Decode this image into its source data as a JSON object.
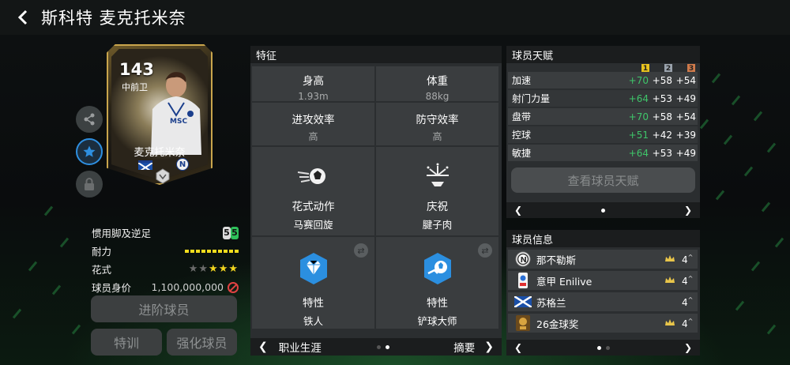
{
  "header": {
    "title": "斯科特 麦克托米奈"
  },
  "card": {
    "rating": "143",
    "position": "中前卫",
    "name": "麦克托米奈"
  },
  "left_stats": {
    "foot_label": "惯用脚及逆足",
    "foot_values": [
      "5",
      "5"
    ],
    "stamina_label": "耐力",
    "stamina_segments": 10,
    "skill_label": "花式",
    "skill_stars": {
      "total": 5,
      "filled": 3
    },
    "value_label": "球员身价",
    "value": "1,100,000,000"
  },
  "buttons": {
    "upgrade": "进阶球员",
    "train": "特训",
    "enhance": "强化球员",
    "view_talent": "查看球员天赋"
  },
  "features": {
    "title": "特征",
    "height_label": "身高",
    "height_value": "1.93m",
    "weight_label": "体重",
    "weight_value": "88kg",
    "attack_label": "进攻效率",
    "attack_value": "高",
    "defense_label": "防守效率",
    "defense_value": "高",
    "skill_move_label": "花式动作",
    "skill_move_value": "马赛回旋",
    "celebration_label": "庆祝",
    "celebration_value": "腱子肉",
    "trait1_label": "特性",
    "trait1_value": "铁人",
    "trait2_label": "特性",
    "trait2_value": "铲球大师",
    "footer_left": "职业生涯",
    "footer_right": "摘要"
  },
  "talent": {
    "title": "球员天赋",
    "tiers": [
      "1",
      "2",
      "3"
    ],
    "tier_colors": [
      "#e8c21d",
      "#9aa3ad",
      "#d07a4a"
    ],
    "rows": [
      {
        "name": "加速",
        "v1": "+70",
        "v2": "+58",
        "v3": "+54"
      },
      {
        "name": "射门力量",
        "v1": "+64",
        "v2": "+53",
        "v3": "+49"
      },
      {
        "name": "盘带",
        "v1": "+70",
        "v2": "+58",
        "v3": "+54"
      },
      {
        "name": "控球",
        "v1": "+51",
        "v2": "+42",
        "v3": "+39"
      },
      {
        "name": "敏捷",
        "v1": "+64",
        "v2": "+53",
        "v3": "+49"
      }
    ]
  },
  "player_info": {
    "title": "球员信息",
    "rows": [
      {
        "icon": "napoli-club-icon",
        "text": "那不勒斯",
        "level": "4"
      },
      {
        "icon": "serie-a-league-icon",
        "text": "意甲 Enilive",
        "level": "4"
      },
      {
        "icon": "scotland-flag-icon",
        "text": "苏格兰",
        "level": "4"
      },
      {
        "icon": "golden-award-icon",
        "text": "26金球奖",
        "level": "4"
      }
    ]
  },
  "colors": {
    "accent_green": "#3fc56a",
    "star_gold": "#f1d51f",
    "stamina_yellow": "#f2dc1d",
    "trait_blue": "#2b8fe0"
  }
}
